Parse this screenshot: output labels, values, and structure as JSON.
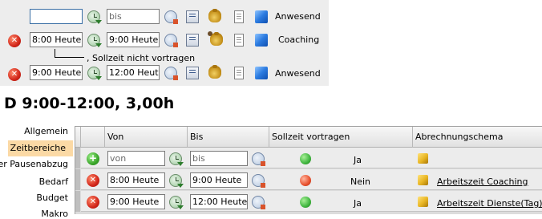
{
  "top": {
    "rows": [
      {
        "from_value": "",
        "to_placeholder": "bis",
        "to_value": "",
        "label": "Anwesend"
      },
      {
        "from_value": "8:00 Heute",
        "to_value": "9:00 Heute",
        "label": "Coaching"
      },
      {
        "from_value": "9:00 Heute",
        "to_value": "12:00 Heute",
        "label": "Anwesend"
      }
    ],
    "connector_text": ", Sollzeit nicht vortragen"
  },
  "heading": "D 9:00-12:00, 3,00h",
  "sidebar": {
    "items": [
      "Allgemein",
      "Zeitbereiche",
      "er Pausenabzug",
      "Bedarf",
      "Budget",
      "Makro"
    ],
    "active_index": 1
  },
  "grid": {
    "columns": [
      "Von",
      "Bis",
      "Sollzeit vortragen",
      "Abrechnungschema"
    ],
    "rows": [
      {
        "action": "add",
        "from": "",
        "from_placeholder": "von",
        "to": "",
        "to_placeholder": "bis",
        "status": "green",
        "vortragen": "Ja",
        "schema": ""
      },
      {
        "action": "delete",
        "from": "8:00 Heute",
        "to": "9:00 Heute",
        "status": "red",
        "vortragen": "Nein",
        "schema": "Arbeitszeit Coaching"
      },
      {
        "action": "delete",
        "from": "9:00 Heute",
        "to": "12:00 Heute",
        "status": "green",
        "vortragen": "Ja",
        "schema": "Arbeitszeit Dienste(Tag)  S"
      }
    ]
  },
  "colors": {
    "active_tab": "#fbd9a5",
    "status_green": "#3fb53f",
    "status_red": "#e8502d"
  }
}
